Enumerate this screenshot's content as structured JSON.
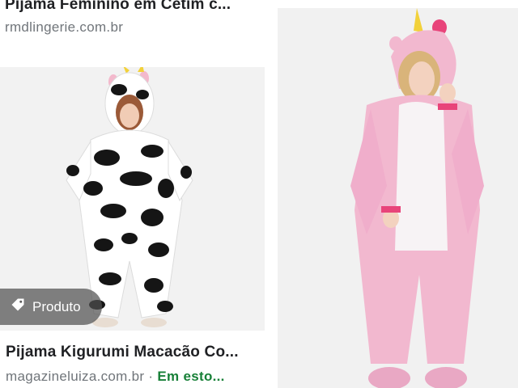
{
  "results": [
    {
      "title": "Pijama Feminino em Cetim c...",
      "source": "rmdlingerie.com.br"
    },
    {
      "title": "Pijama Kigurumi Macacão Co...",
      "source": "magazineluiza.com.br",
      "separator": "·",
      "stock": "Em esto...",
      "badge": "Produto",
      "badge_icon": "tag-icon",
      "image": "cow-kigurumi-photo"
    },
    {
      "image": "unicorn-kigurumi-photo"
    }
  ],
  "colors": {
    "title": "#202124",
    "source": "#70757a",
    "stock": "#188038",
    "cow_bg": "#f2f2f2",
    "unicorn_bg": "#f1f1f1",
    "pink": "#f2b8cf"
  }
}
